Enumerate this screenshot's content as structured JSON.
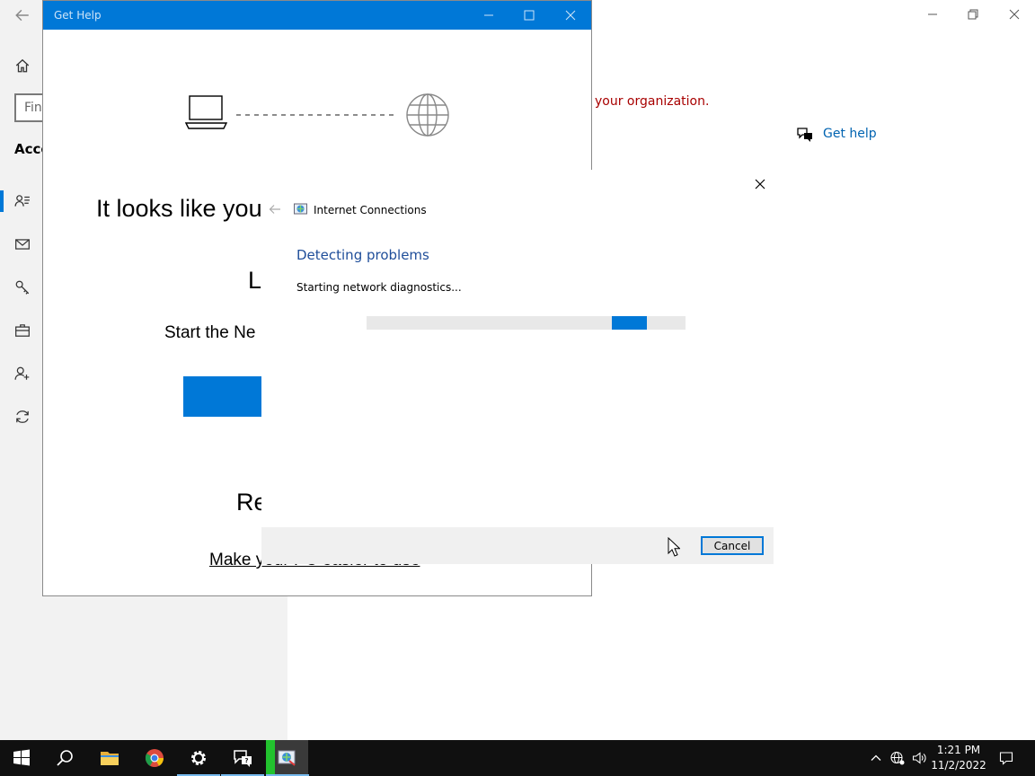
{
  "settings": {
    "search_placeholder": "Find",
    "section_heading": "Acco",
    "org_message": "your organization.",
    "get_help_label": "Get help",
    "sidebar_icons": [
      "home-icon",
      "your-info-icon",
      "email-icon",
      "sign-in-key-icon",
      "work-access-icon",
      "family-icon",
      "sync-icon"
    ]
  },
  "get_help": {
    "title": "Get Help",
    "headline": "It looks like you",
    "letter": "L",
    "start_text": "Start the Ne",
    "re_text": "Re",
    "link_text": "Make your PC easier to use"
  },
  "troubleshooter": {
    "app_name": "Internet Connections",
    "heading": "Detecting problems",
    "status": "Starting network diagnostics...",
    "progress": {
      "start": 0.77,
      "end": 0.88
    },
    "cancel_label": "Cancel"
  },
  "taskbar": {
    "time": "1:21 PM",
    "date": "11/2/2022",
    "items": [
      "start-icon",
      "search-icon",
      "file-explorer-icon",
      "chrome-icon",
      "settings-icon",
      "get-help-icon",
      "network-troubleshooter-icon"
    ],
    "tray": [
      "show-hidden-icons-icon",
      "network-icon",
      "volume-icon",
      "action-center-icon"
    ]
  },
  "colors": {
    "accent": "#0078d7",
    "error_text": "#a80000",
    "link": "#0063b1",
    "taskbar": "#101010"
  }
}
